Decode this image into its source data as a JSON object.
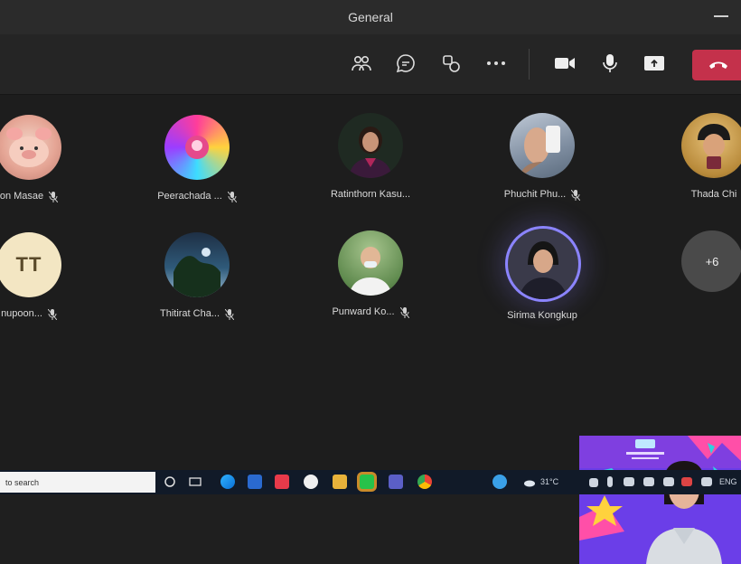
{
  "window": {
    "title": "General"
  },
  "participants_row1": [
    {
      "name": "on Masae",
      "type": "photo",
      "bg": "#e8b9a8"
    },
    {
      "name": "Peerachada ...",
      "type": "photo",
      "bg": "#e64aa0"
    },
    {
      "name": "Ratinthorn Kasu...",
      "type": "photo",
      "bg": "#2f3b2f"
    },
    {
      "name": "Phuchit Phu...",
      "type": "photo",
      "bg": "#d8c6b6"
    },
    {
      "name": "Thada Chi",
      "type": "photo",
      "bg": "#caa14b"
    }
  ],
  "participants_row2": [
    {
      "name": "nupoon...",
      "type": "initials",
      "initials": "TT",
      "bg": "#f3e6c3"
    },
    {
      "name": "Thitirat Cha...",
      "type": "photo",
      "bg": "#2c4b6c"
    },
    {
      "name": "Punward Ko...",
      "type": "photo",
      "bg": "#7da06b"
    },
    {
      "name": "Sirima Kongkup",
      "type": "photo",
      "bg": "#3a3a4a",
      "speaking": true
    }
  ],
  "more": {
    "label": "+6"
  },
  "taskbar": {
    "search_text": "to search",
    "weather": "31°C",
    "lang": "ENG"
  },
  "colors": {
    "leave_red": "#c4314b",
    "speaking_ring": "#8b84ff",
    "taskbar": "#111a28"
  }
}
